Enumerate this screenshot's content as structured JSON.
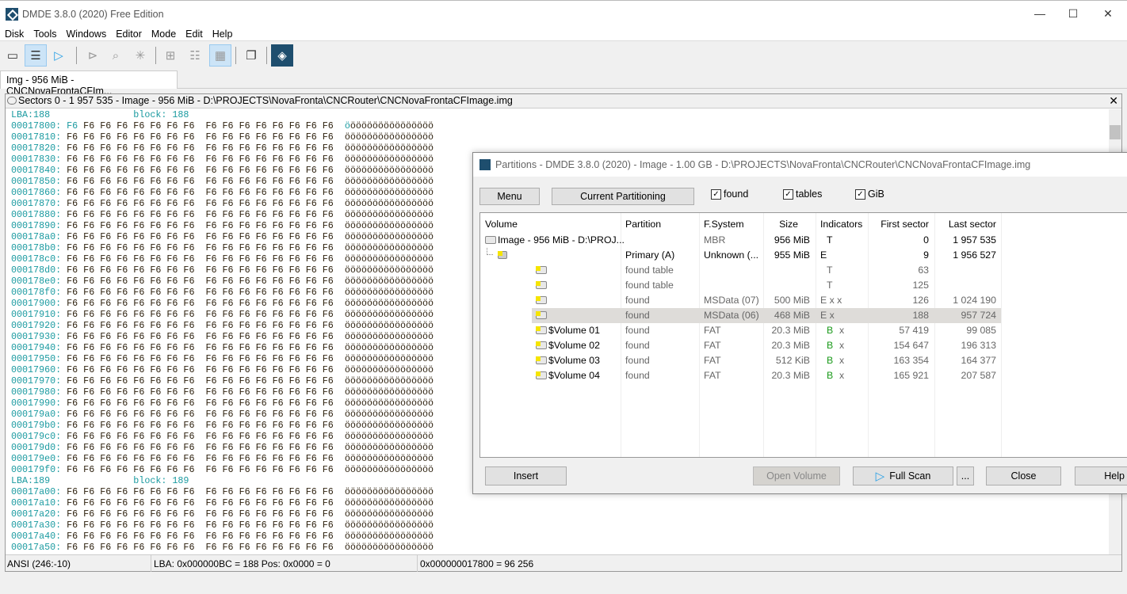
{
  "window": {
    "title": "DMDE 3.8.0 (2020) Free Edition",
    "minimize": "—",
    "maximize": "☐",
    "close": "✕"
  },
  "menu": [
    "Disk",
    "Tools",
    "Windows",
    "Editor",
    "Mode",
    "Edit",
    "Help"
  ],
  "toolbar": [
    {
      "icon": "disk-icon",
      "active": false
    },
    {
      "icon": "partitions-icon",
      "active": true
    },
    {
      "icon": "play-icon",
      "active": false
    },
    {
      "icon": "step-icon",
      "active": false
    },
    {
      "icon": "find-icon",
      "active": false
    },
    {
      "icon": "new-icon",
      "active": false
    },
    {
      "icon": "tree-view-icon",
      "active": false
    },
    {
      "icon": "list-view-icon",
      "active": false
    },
    {
      "icon": "hex-view-icon",
      "active": true
    },
    {
      "icon": "windows-icon",
      "active": false
    },
    {
      "icon": "dmde-logo-icon",
      "active": false
    }
  ],
  "tab": {
    "label": "Img - 956 MiB - CNCNovaFrontaCFIm..."
  },
  "panel": {
    "title": "Sectors 0 - 1 957 535 - Image - 956 MiB - D:\\PROJECTS\\NovaFronta\\CNCRouter\\CNCNovaFrontaCFImage.img",
    "close": "✕"
  },
  "hex": {
    "lba1": "LBA:188               block: 188",
    "lba2": "LBA:189               block: 189",
    "bytes": "F6 F6 F6 F6 F6 F6 F6 F6  F6 F6 F6 F6 F6 F6 F6 F6",
    "ascii": "öööööööööööööööö",
    "rows1": [
      "00017800:",
      "00017810:",
      "00017820:",
      "00017830:",
      "00017840:",
      "00017850:",
      "00017860:",
      "00017870:",
      "00017880:",
      "00017890:",
      "000178a0:",
      "000178b0:",
      "000178c0:",
      "000178d0:",
      "000178e0:",
      "000178f0:",
      "00017900:",
      "00017910:",
      "00017920:",
      "00017930:",
      "00017940:",
      "00017950:",
      "00017960:",
      "00017970:",
      "00017980:",
      "00017990:",
      "000179a0:",
      "000179b0:",
      "000179c0:",
      "000179d0:",
      "000179e0:",
      "000179f0:"
    ],
    "rows2": [
      "00017a00:",
      "00017a10:",
      "00017a20:",
      "00017a30:",
      "00017a40:",
      "00017a50:"
    ]
  },
  "status": {
    "encoding": "ANSI (246:-10)",
    "lba": "LBA: 0x000000BC = 188  Pos: 0x0000 = 0",
    "offset": "0x000000017800 = 96 256"
  },
  "dialog": {
    "title": "Partitions - DMDE 3.8.0 (2020) - Image - 1.00 GB - D:\\PROJECTS\\NovaFronta\\CNCRouter\\CNCNovaFrontaCFImage.img",
    "menu_btn": "Menu",
    "current_btn": "Current Partitioning",
    "checks": [
      {
        "label": "found",
        "checked": true
      },
      {
        "label": "tables",
        "checked": true
      },
      {
        "label": "GiB",
        "checked": true
      }
    ],
    "columns": [
      "Volume",
      "Partition",
      "F.System",
      "Size",
      "Indicators",
      "First sector",
      "Last sector"
    ],
    "rows": [
      {
        "volume": "Image - 956 MiB - D:\\PROJ...",
        "partition": "",
        "fs": "MBR",
        "size": "956 MiB",
        "ind": "T",
        "ind2": "",
        "first": "0",
        "last": "1 957 535",
        "icon": "disk",
        "bold": true,
        "grey_fs": true
      },
      {
        "volume": "",
        "partition": "Primary (A)",
        "fs": "Unknown (...",
        "size": "955 MiB",
        "ind": "E",
        "ind2": "",
        "first": "9",
        "last": "1 956 527",
        "icon": "unknown",
        "bold": true
      },
      {
        "volume": "",
        "partition": "found table",
        "fs": "",
        "size": "",
        "ind": "T",
        "ind2": "",
        "first": "63",
        "last": "",
        "icon": "table"
      },
      {
        "volume": "",
        "partition": "found table",
        "fs": "",
        "size": "",
        "ind": "T",
        "ind2": "",
        "first": "125",
        "last": "",
        "icon": "table"
      },
      {
        "volume": "",
        "partition": "found",
        "fs": "MSData (07)",
        "size": "500 MiB",
        "ind": "E x x",
        "ind2": "",
        "first": "126",
        "last": "1 024 190",
        "icon": "vol"
      },
      {
        "volume": "",
        "partition": "found",
        "fs": "MSData (06)",
        "size": "468 MiB",
        "ind": "E x",
        "ind2": "",
        "first": "188",
        "last": "957 724",
        "icon": "vol",
        "selected": true
      },
      {
        "volume": "$Volume 01",
        "partition": "found",
        "fs": "FAT",
        "size": "20.3 MiB",
        "ind": "B",
        "ind2": "x",
        "first": "57 419",
        "last": "99 085",
        "icon": "vol"
      },
      {
        "volume": "$Volume 02",
        "partition": "found",
        "fs": "FAT",
        "size": "20.3 MiB",
        "ind": "B",
        "ind2": "x",
        "first": "154 647",
        "last": "196 313",
        "icon": "vol"
      },
      {
        "volume": "$Volume 03",
        "partition": "found",
        "fs": "FAT",
        "size": "512 KiB",
        "ind": "B",
        "ind2": "x",
        "first": "163 354",
        "last": "164 377",
        "icon": "vol"
      },
      {
        "volume": "$Volume 04",
        "partition": "found",
        "fs": "FAT",
        "size": "20.3 MiB",
        "ind": "B",
        "ind2": "x",
        "first": "165 921",
        "last": "207 587",
        "icon": "vol"
      }
    ],
    "buttons": {
      "insert": "Insert",
      "open_volume": "Open Volume",
      "full_scan": "Full Scan",
      "more": "...",
      "close": "Close",
      "help": "Help"
    }
  }
}
